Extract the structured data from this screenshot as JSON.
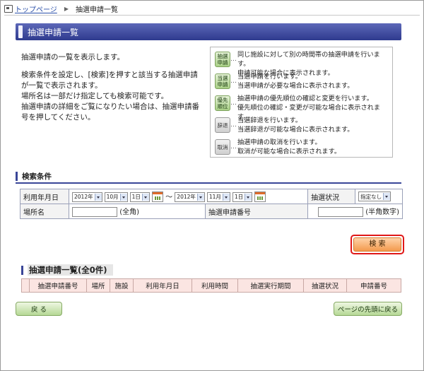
{
  "breadcrumb": {
    "home": "トップページ",
    "current": "抽選申請一覧"
  },
  "page_title": "抽選申請一覧",
  "description": [
    "抽選申請の一覧を表示します。",
    "検索条件を設定し、[検索]を押すと該当する抽選申請が一覧で表示されます。\n場所名は一部だけ指定しても検索可能です。\n抽選申請の詳細をご覧になりたい場合は、抽選申請番号を押してください。"
  ],
  "legend": [
    {
      "btn1": "抽選",
      "btn2": "申請",
      "style": "green",
      "line1": "同じ施設に対して別の時間帯の抽選申請を行います。",
      "line2": "申請可能な場合に表示されます。"
    },
    {
      "btn1": "当選",
      "btn2": "申請",
      "style": "green",
      "line1": "当選申請を行います。",
      "line2": "当選申請が必要な場合に表示されます。"
    },
    {
      "btn1": "優先",
      "btn2": "順位",
      "style": "green",
      "line1": "抽選申請の優先順位の確認と変更を行います。",
      "line2": "優先順位の確認・変更が可能な場合に表示されます。"
    },
    {
      "btn1": "辞退",
      "btn2": "",
      "style": "gray",
      "line1": "当選辞退を行います。",
      "line2": "当選辞退が可能な場合に表示されます。"
    },
    {
      "btn1": "取消",
      "btn2": "",
      "style": "gray",
      "line1": "抽選申請の取消を行います。",
      "line2": "取消が可能な場合に表示されます。"
    }
  ],
  "search": {
    "section_title": "検索条件",
    "date_label": "利用年月日",
    "from": {
      "year": "2012年",
      "month": "10月",
      "day": "1日"
    },
    "tilde": "〜",
    "to": {
      "year": "2012年",
      "month": "11月",
      "day": "1日"
    },
    "status_label": "抽選状況",
    "status_value": "指定なし",
    "place_label": "場所名",
    "place_hint": "(全角)",
    "number_label": "抽選申請番号",
    "number_hint": "(半角数字)",
    "button": "検 索"
  },
  "list": {
    "title": "抽選申請一覧(全0件)",
    "columns": [
      "",
      "抽選申請番号",
      "場所",
      "施設",
      "利用年月日",
      "利用時間",
      "抽選実行期間",
      "抽選状況",
      "申請番号"
    ]
  },
  "footer": {
    "back": "戻 る",
    "top": "ページの先頭に戻る"
  },
  "colors": {
    "accent": "#2e3a8e",
    "search_border": "#e01818"
  }
}
